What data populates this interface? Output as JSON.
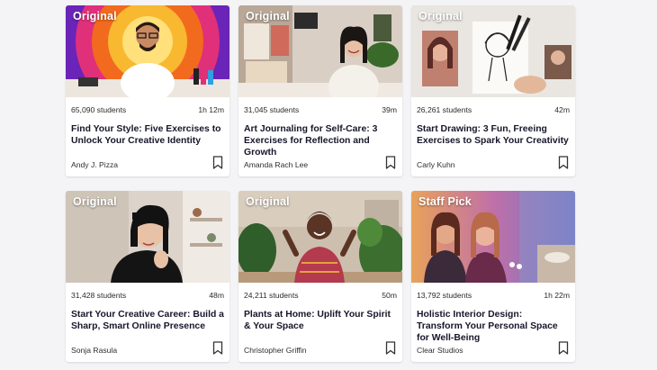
{
  "courses": [
    {
      "badge": "Original",
      "students": "65,090 students",
      "duration": "1h 12m",
      "title": "Find Your Style: Five Exercises to Unlock Your Creative Identity",
      "author": "Andy J. Pizza",
      "thumb_colors": [
        "#7a2cc0",
        "#f08a1c",
        "#ffd84a"
      ]
    },
    {
      "badge": "Original",
      "students": "31,045 students",
      "duration": "39m",
      "title": "Art Journaling for Self-Care: 3 Exercises for Reflection and Growth",
      "author": "Amanda Rach Lee",
      "thumb_colors": [
        "#c9b8a8",
        "#e9e2da",
        "#2a2420"
      ]
    },
    {
      "badge": "Original",
      "students": "26,261 students",
      "duration": "42m",
      "title": "Start Drawing: 3 Fun, Freeing Exercises to Spark Your Creativity",
      "author": "Carly Kuhn",
      "thumb_colors": [
        "#e6e2dc",
        "#b07060",
        "#3a3030"
      ]
    },
    {
      "badge": "Original",
      "students": "31,428 students",
      "duration": "48m",
      "title": "Start Your Creative Career: Build a Sharp, Smart Online Presence",
      "author": "Sonja Rasula",
      "thumb_colors": [
        "#d8cfc6",
        "#eee8e2",
        "#1a1a1a"
      ]
    },
    {
      "badge": "Original",
      "students": "24,211 students",
      "duration": "50m",
      "title": "Plants at Home: Uplift Your Spirit & Your Space",
      "author": "Christopher Griffin",
      "thumb_colors": [
        "#c8b49a",
        "#4a7a3a",
        "#b04a5a"
      ]
    },
    {
      "badge": "Staff Pick",
      "students": "13,792 students",
      "duration": "1h 22m",
      "title": "Holistic Interior Design: Transform Your Personal Space for Well-Being",
      "author": "Clear Studios",
      "thumb_colors": [
        "#e0a060",
        "#b050a0",
        "#6070c0"
      ]
    }
  ]
}
